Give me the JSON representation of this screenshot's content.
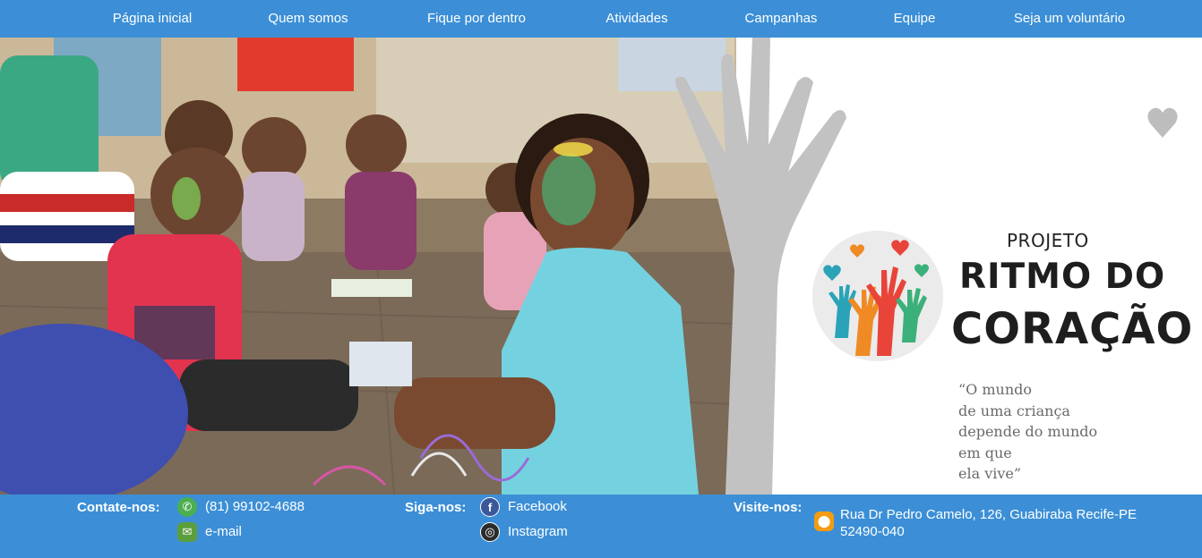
{
  "nav": {
    "items": [
      {
        "label": "Página inicial"
      },
      {
        "label": "Quem somos"
      },
      {
        "label": "Fique por dentro"
      },
      {
        "label": "Atividades"
      },
      {
        "label": "Campanhas"
      },
      {
        "label": "Equipe"
      },
      {
        "label": "Seja um voluntário"
      }
    ]
  },
  "hero": {
    "brand": {
      "projeto": "PROJETO",
      "line1": "RITMO DO",
      "line2": "CORAÇÃO"
    },
    "quote": [
      "“O mundo",
      "de uma criança",
      "depende do mundo",
      "em que",
      "ela vive”"
    ]
  },
  "footer": {
    "contact": {
      "label": "Contate-nos:",
      "phone": "(81) 99102-4688",
      "email": "e-mail"
    },
    "social": {
      "label": "Siga-nos:",
      "facebook": "Facebook",
      "instagram": "Instagram"
    },
    "visit": {
      "label": "Visite-nos:",
      "address_line1": "Rua Dr Pedro Camelo, 126, Guabiraba Recife-PE",
      "address_line2": "52490-040"
    }
  },
  "colors": {
    "primary_blue": "#3c8fd6",
    "white": "#ffffff"
  },
  "icons": [
    "whatsapp-icon",
    "mail-icon",
    "facebook-icon",
    "instagram-icon",
    "location-pin-icon",
    "heart-outline-icon"
  ]
}
